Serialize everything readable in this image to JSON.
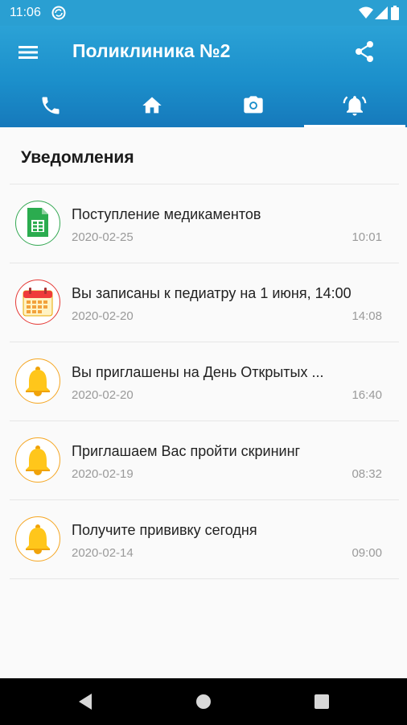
{
  "status_bar": {
    "time": "11:06"
  },
  "app_bar": {
    "title": "Поликлиника №2"
  },
  "tabs": [
    {
      "icon": "phone-icon"
    },
    {
      "icon": "home-icon"
    },
    {
      "icon": "camera-icon"
    },
    {
      "icon": "bell-icon",
      "active": true
    }
  ],
  "section": {
    "heading": "Уведомления"
  },
  "notifications": [
    {
      "icon": "spreadsheet-icon",
      "ring_color": "#34a853",
      "text": "Поступление медикаментов",
      "date": "2020-02-25",
      "time": "10:01"
    },
    {
      "icon": "calendar-icon",
      "ring_color": "#e53935",
      "text": "Вы записаны к педиатру на 1 июня, 14:00",
      "date": "2020-02-20",
      "time": "14:08"
    },
    {
      "icon": "bell-icon",
      "ring_color": "#f5a623",
      "text": "Вы приглашены на День Открытых ...",
      "date": "2020-02-20",
      "time": "16:40"
    },
    {
      "icon": "bell-icon",
      "ring_color": "#f5a623",
      "text": "Приглашаем Вас пройти скрининг",
      "date": "2020-02-19",
      "time": "08:32"
    },
    {
      "icon": "bell-icon",
      "ring_color": "#f5a623",
      "text": "Получите прививку сегодня",
      "date": "2020-02-14",
      "time": "09:00"
    }
  ],
  "colors": {
    "primary": "#1b8fcb",
    "status_bar": "#2a9fd2"
  },
  "nav_bar": [
    {
      "icon": "back-icon"
    },
    {
      "icon": "home-circle-icon"
    },
    {
      "icon": "recents-icon"
    }
  ]
}
